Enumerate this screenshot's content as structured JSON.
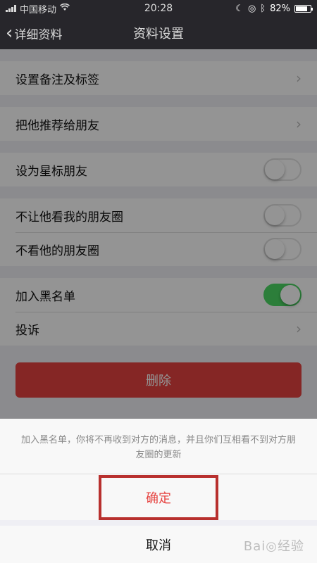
{
  "status_bar": {
    "carrier": "中国移动",
    "time": "20:28",
    "battery_percent": "82%",
    "battery_level": 0.82
  },
  "nav": {
    "back_label": "详细资料",
    "title": "资料设置"
  },
  "settings": {
    "remark_tags": "设置备注及标签",
    "recommend": "把他推荐给朋友",
    "star_friend": "设为星标朋友",
    "hide_moments_from": "不让他看我的朋友圈",
    "hide_his_moments": "不看他的朋友圈",
    "blacklist": "加入黑名单",
    "report": "投诉",
    "delete": "删除"
  },
  "toggles": {
    "star_friend": false,
    "hide_moments_from": false,
    "hide_his_moments": false,
    "blacklist": true
  },
  "action_sheet": {
    "message": "加入黑名单，你将不再收到对方的消息，并且你们互相看不到对方朋友圈的更新",
    "confirm": "确定",
    "cancel": "取消"
  },
  "colors": {
    "nav_bg": "#2e2d33",
    "danger": "#e64340",
    "switch_on": "#4cd964",
    "highlight_frame": "#b8302e"
  }
}
